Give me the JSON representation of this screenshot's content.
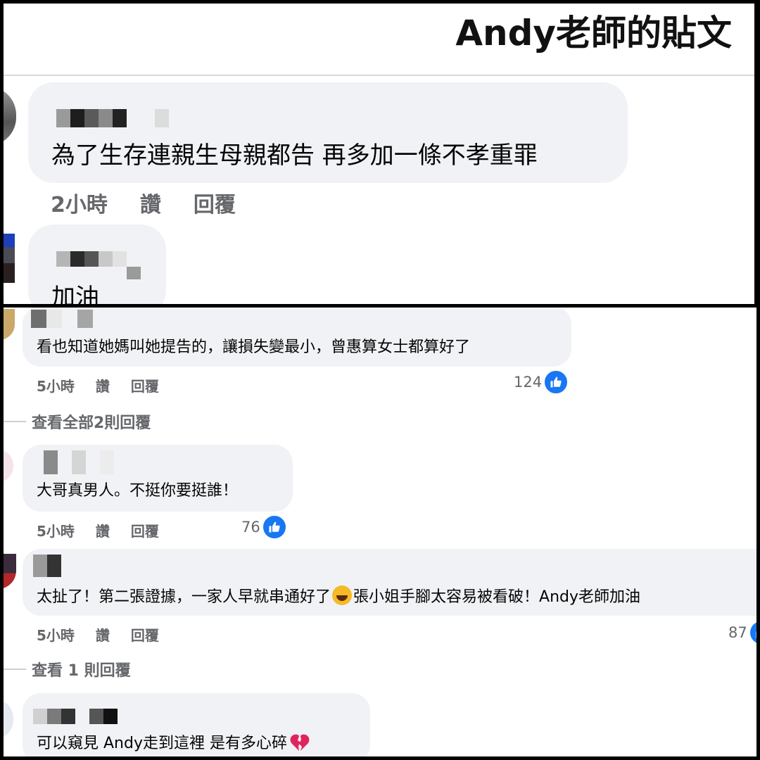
{
  "post_title": "Andy老師的貼文",
  "comments_top": [
    {
      "text": "為了生存連親生母親都告 再多加一條不孝重罪",
      "time": "2小時",
      "like_label": "讚",
      "reply_label": "回覆"
    },
    {
      "text": "加油"
    }
  ],
  "comments_bottom": [
    {
      "text": "看也知道她媽叫她提告的，讓損失變最小，曾惠算女士都算好了",
      "time": "5小時",
      "like_label": "讚",
      "reply_label": "回覆",
      "likes": "124",
      "view_replies": "查看全部2則回覆"
    },
    {
      "text": "大哥真男人。不挺你要挺誰！",
      "time": "5小時",
      "like_label": "讚",
      "reply_label": "回覆",
      "likes": "76"
    },
    {
      "text_before": "太扯了！第二張證據，一家人早就串通好了",
      "text_after": "張小姐手腳太容易被看破！Andy老師加油",
      "time": "5小時",
      "like_label": "讚",
      "reply_label": "回覆",
      "likes": "87",
      "view_replies": "查看 1 則回覆"
    },
    {
      "text": "可以窺見 Andy走到這裡 是有多心碎"
    }
  ],
  "icons": {
    "like": "thumbs-up-icon",
    "emoji_laugh": "tears-of-joy-emoji",
    "emoji_broken_heart": "broken-heart-emoji"
  },
  "colors": {
    "bubble": "#f0f2f5",
    "meta_text": "#65676b",
    "like_blue": "#1877f2",
    "broken_heart": "#e0245e"
  }
}
